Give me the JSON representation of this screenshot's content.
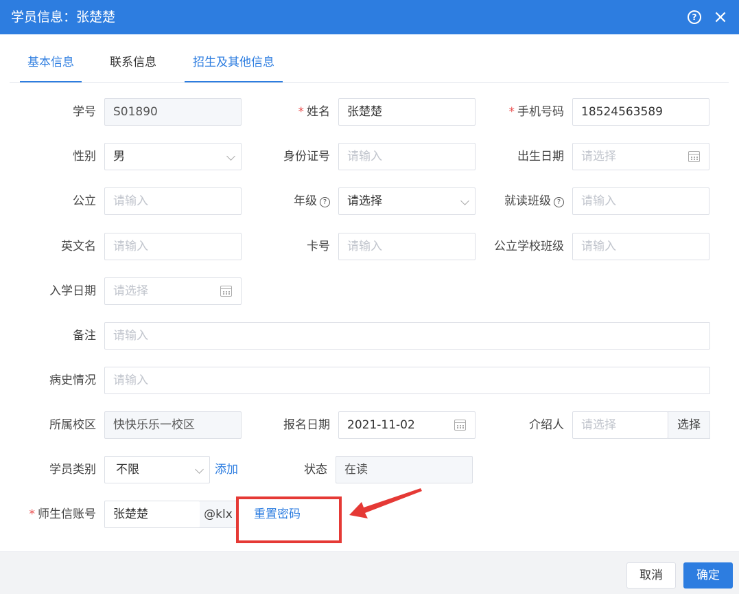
{
  "dialog": {
    "title": "学员信息：张楚楚"
  },
  "tabs": [
    "基本信息",
    "联系信息",
    "招生及其他信息"
  ],
  "form": {
    "student_no": {
      "label": "学号",
      "value": "S01890"
    },
    "name": {
      "label": "姓名",
      "value": "张楚楚"
    },
    "phone": {
      "label": "手机号码",
      "value": "18524563589"
    },
    "gender": {
      "label": "性别",
      "value": "男"
    },
    "id_card": {
      "label": "身份证号",
      "placeholder": "请输入"
    },
    "birth_date": {
      "label": "出生日期",
      "placeholder": "请选择"
    },
    "public_school": {
      "label": "公立",
      "placeholder": "请输入"
    },
    "grade": {
      "label": "年级",
      "placeholder": "请选择"
    },
    "class": {
      "label": "就读班级",
      "placeholder": "请输入"
    },
    "english_name": {
      "label": "英文名",
      "placeholder": "请输入"
    },
    "card_no": {
      "label": "卡号",
      "placeholder": "请输入"
    },
    "public_school_class": {
      "label": "公立学校班级",
      "placeholder": "请输入"
    },
    "enroll_date": {
      "label": "入学日期",
      "placeholder": "请选择"
    },
    "remark": {
      "label": "备注",
      "placeholder": "请输入"
    },
    "medical_history": {
      "label": "病史情况",
      "placeholder": "请输入"
    },
    "campus": {
      "label": "所属校区",
      "value": "快快乐乐一校区"
    },
    "signup_date": {
      "label": "报名日期",
      "value": "2021-11-02"
    },
    "referrer": {
      "label": "介绍人",
      "placeholder": "请选择",
      "button": "选择"
    },
    "student_type": {
      "label": "学员类别",
      "value": "不限",
      "add_link": "添加"
    },
    "status": {
      "label": "状态",
      "value": "在读"
    },
    "account": {
      "label": "师生信账号",
      "value": "张楚楚",
      "suffix": "@klx",
      "reset_link": "重置密码"
    }
  },
  "required_mark": "*",
  "help_glyph": "?",
  "close_glyph": "×",
  "footer": {
    "cancel": "取消",
    "confirm": "确定"
  },
  "annotation": {
    "color": "#e53935"
  }
}
